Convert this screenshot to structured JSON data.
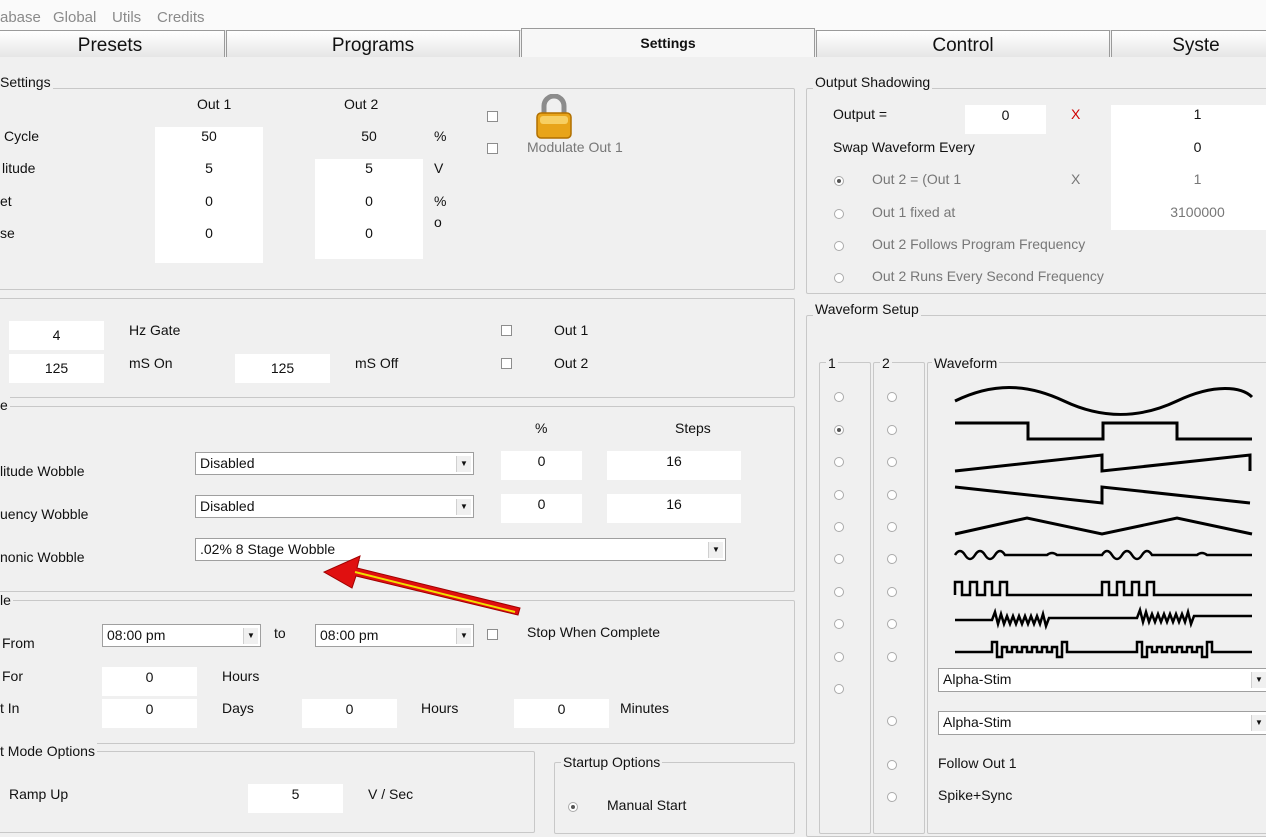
{
  "menu": [
    "abase",
    "Global",
    "Utils",
    "Credits"
  ],
  "tabs": [
    "Presets",
    "Programs",
    "Settings",
    "Control",
    "Syste"
  ],
  "settings": {
    "title": "Settings",
    "col_out1": "Out 1",
    "col_out2": "Out 2",
    "rows": [
      {
        "label": "Cycle",
        "out1": "50",
        "out2": "50",
        "unit": "%"
      },
      {
        "label": "litude",
        "out1": "5",
        "out2": "5",
        "unit": "V"
      },
      {
        "label": "et",
        "out1": "0",
        "out2": "0",
        "unit": "%"
      },
      {
        "label": "se",
        "out1": "0",
        "out2": "0",
        "unit": "o"
      }
    ],
    "modulate_label": "Modulate Out 1"
  },
  "gate": {
    "hz_value": "4",
    "hz_label": "Hz Gate",
    "on_value": "125",
    "on_label": "mS On",
    "off_value": "125",
    "off_label": "mS Off",
    "out1_label": "Out 1",
    "out2_label": "Out 2"
  },
  "wobble": {
    "title": "e",
    "col_percent": "%",
    "col_steps": "Steps",
    "amp_label": "litude Wobble",
    "amp_select": "Disabled",
    "amp_percent": "0",
    "amp_steps": "16",
    "freq_label": "uency Wobble",
    "freq_select": "Disabled",
    "freq_percent": "0",
    "freq_steps": "16",
    "harm_label": "nonic Wobble",
    "harm_select": ".02% 8 Stage Wobble"
  },
  "schedule": {
    "title": "le",
    "from_label": "From",
    "from_value": "08:00 pm",
    "to_label": "to",
    "to_value": "08:00 pm",
    "stop_label": "Stop When Complete",
    "for_label": "For",
    "for_value": "0",
    "for_unit": "Hours",
    "in_label": "t In",
    "days_value": "0",
    "days_label": "Days",
    "hours_value": "0",
    "hours_label": "Hours",
    "minutes_value": "0",
    "minutes_label": "Minutes"
  },
  "mode_options": {
    "title": "t Mode Options",
    "ramp_label": "Ramp Up",
    "ramp_value": "5",
    "ramp_unit": "V / Sec"
  },
  "startup": {
    "title": "Startup Options",
    "manual_label": "Manual Start"
  },
  "shadowing": {
    "title": "Output Shadowing",
    "output_label": "Output =",
    "output_value": "0",
    "x1": "X",
    "mult_value": "1",
    "swap_label": "Swap Waveform Every",
    "swap_value": "0",
    "out2_eq_label": "Out 2 = (Out 1",
    "x2": "X",
    "out2_mult": "1",
    "fixed_label": "Out 1 fixed at",
    "fixed_value": "3100000",
    "follows_label": "Out 2 Follows Program Frequency",
    "runs_label": "Out 2 Runs Every Second Frequency"
  },
  "waveform": {
    "title": "Waveform Setup",
    "col1": "1",
    "col2": "2",
    "col_wave": "Waveform",
    "waves": [
      "sine",
      "square",
      "sawtooth-up",
      "sawtooth-down",
      "triangle",
      "modulated-sine",
      "burst-square",
      "spike-burst",
      "spike-square-burst"
    ],
    "select1": "Alpha-Stim",
    "select2": "Alpha-Stim",
    "follow_label": "Follow Out 1",
    "spike_label": "Spike+Sync"
  },
  "colors": {
    "accent_red": "#d00000",
    "arrow_red": "#e01010",
    "arrow_yellow": "#f0e000"
  }
}
